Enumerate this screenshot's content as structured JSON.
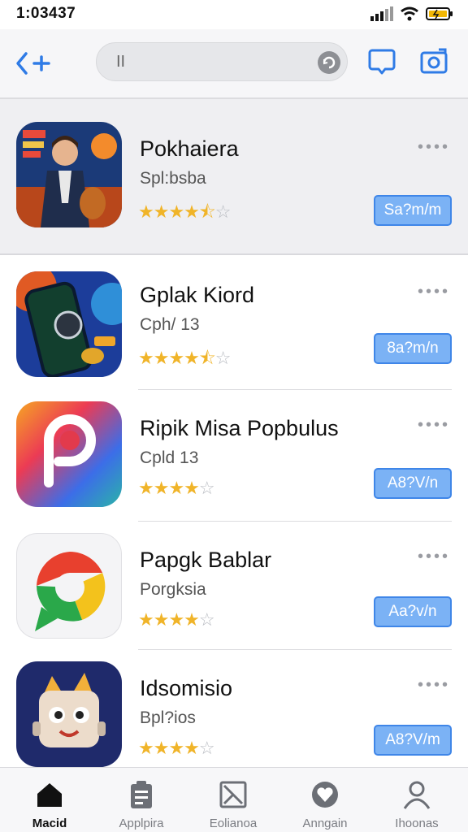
{
  "status": {
    "time": "1:03437"
  },
  "search": {
    "query": "II"
  },
  "apps": [
    {
      "name": "Pokhaiera",
      "subtitle": "Spl:bsba",
      "rating": 4.5,
      "button": "Sa?m/m"
    },
    {
      "name": "Gplak Kiord",
      "subtitle": "Cph/ 13",
      "rating": 4.5,
      "button": "8a?m/n"
    },
    {
      "name": "Ripik Misa Popbulus",
      "subtitle": "Cpld 13",
      "rating": 4,
      "button": "A8?V/n"
    },
    {
      "name": "Papgk Bablar",
      "subtitle": "Porgksia",
      "rating": 4,
      "button": "Aa?v/n"
    },
    {
      "name": "Idsomisio",
      "subtitle": "Bpl?ios",
      "rating": 4,
      "button": "A8?V/m"
    }
  ],
  "tabs": [
    {
      "label": "Macid",
      "icon": "home-icon",
      "active": true
    },
    {
      "label": "Applpira",
      "icon": "clipboard-icon",
      "active": false
    },
    {
      "label": "Eolianoa",
      "icon": "checkbox-icon",
      "active": false
    },
    {
      "label": "Anngain",
      "icon": "heart-badge-icon",
      "active": false
    },
    {
      "label": "Ihoonas",
      "icon": "profile-icon",
      "active": false
    }
  ],
  "colors": {
    "accent": "#2f7be6",
    "button_fill": "#7bb2f5",
    "star": "#f0b429"
  }
}
